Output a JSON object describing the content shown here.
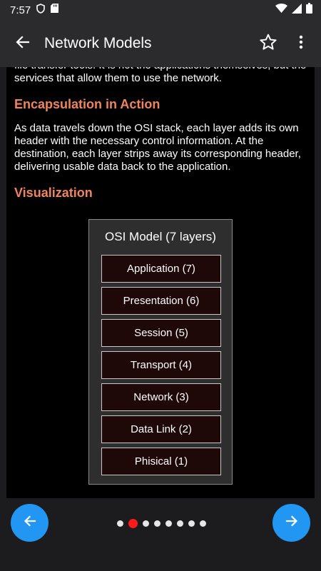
{
  "status_bar": {
    "time": "7:57"
  },
  "app_bar": {
    "title": "Network Models",
    "icons": [
      "arrow-back-icon",
      "star-outline-icon",
      "more-vert-icon"
    ]
  },
  "content": {
    "intro_paragraph": "file transfer tools. It is not the applications themselves, but the services that allow them to use the network.",
    "section1_heading": "Encapsulation in Action",
    "section1_paragraph": "As data travels down the OSI stack, each layer adds its own header with the necessary control information. At the destination, each layer strips away its corresponding header, delivering usable data back to the application.",
    "section2_heading": "Visualization",
    "diagram": {
      "title": "OSI Model (7 layers)",
      "layers": [
        "Application (7)",
        "Presentation (6)",
        "Session (5)",
        "Transport (4)",
        "Network (3)",
        "Data Link (2)",
        "Phisical (1)"
      ]
    }
  },
  "navigation": {
    "page_count": 8,
    "current_page_index": 1,
    "colors": {
      "fab": "#2196f3",
      "active_dot": "#ff1a1a",
      "heading": "#f0845c"
    }
  }
}
